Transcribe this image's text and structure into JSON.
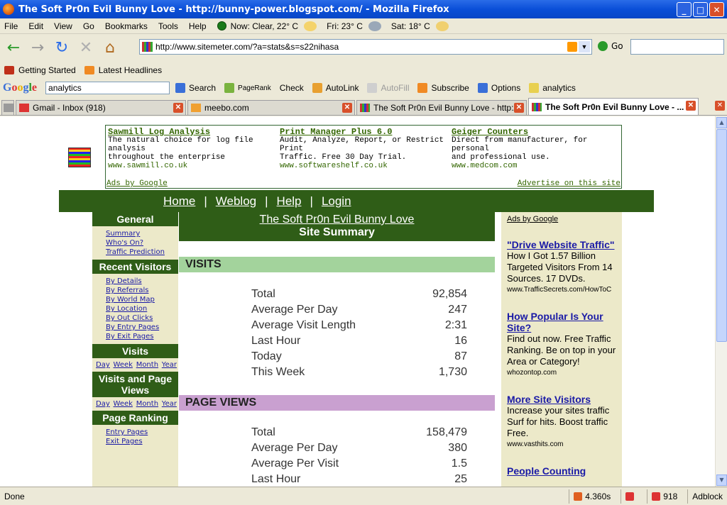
{
  "window": {
    "title": "The Soft Pr0n Evil Bunny Love - http://bunny-power.blogspot.com/ - Mozilla Firefox",
    "min": "_",
    "max": "□",
    "close": "✕"
  },
  "menu": {
    "items": [
      "File",
      "Edit",
      "View",
      "Go",
      "Bookmarks",
      "Tools",
      "Help"
    ],
    "weather_now": "Now: Clear, 22° C",
    "weather_fri": "Fri: 23° C",
    "weather_sat": "Sat: 18° C"
  },
  "nav": {
    "url": "http://www.sitemeter.com/?a=stats&s=s22nihasa",
    "go": "Go",
    "back": "←",
    "forward": "→",
    "reload": "↻",
    "stop": "✕",
    "home": "⌂"
  },
  "bookmarks": [
    "Getting Started",
    "Latest Headlines"
  ],
  "google_toolbar": {
    "logo": "Google",
    "query": "analytics",
    "search": "Search",
    "pagerank": "PageRank",
    "check": "Check",
    "autolink": "AutoLink",
    "autofill": "AutoFill",
    "subscribe": "Subscribe",
    "options": "Options",
    "analytics": "analytics"
  },
  "tabs": [
    "Gmail - Inbox (918)",
    "meebo.com",
    "The Soft Pr0n Evil Bunny Love - http:/...",
    "The Soft Pr0n Evil Bunny Love - ..."
  ],
  "ads": [
    {
      "title": "Sawmill Log Analysis",
      "lines": [
        "The natural choice for log file analysis",
        "throughout the enterprise"
      ],
      "url": "www.sawmill.co.uk"
    },
    {
      "title": "Print Manager Plus 6.0",
      "lines": [
        "Audit, Analyze, Report, or Restrict Print",
        "Traffic. Free 30 Day Trial."
      ],
      "url": "www.softwareshelf.co.uk"
    },
    {
      "title": "Geiger Counters",
      "lines": [
        "Direct from manufacturer, for personal",
        "and professional use."
      ],
      "url": "www.medcom.com"
    }
  ],
  "ads_by": "Ads by Google",
  "advertise": "Advertise on this site",
  "topnav": [
    "Home",
    "Weblog",
    "Help",
    "Login"
  ],
  "sidebar": {
    "general": {
      "title": "General",
      "links": [
        "Summary",
        "Who's On?",
        "Traffic Prediction"
      ]
    },
    "recent": {
      "title": "Recent Visitors",
      "links": [
        "By Details",
        "By Referrals",
        "By World Map",
        "By Location",
        "By Out Clicks",
        "By Entry Pages",
        "By Exit Pages"
      ]
    },
    "visits": {
      "title": "Visits",
      "links": [
        "Day",
        "Week",
        "Month",
        "Year"
      ]
    },
    "pageviews": {
      "title": "Visits and Page Views",
      "links": [
        "Day",
        "Week",
        "Month",
        "Year"
      ]
    },
    "ranking": {
      "title": "Page Ranking",
      "links": [
        "Entry Pages",
        "Exit Pages"
      ]
    }
  },
  "main": {
    "site_name": "The Soft Pr0n Evil Bunny Love",
    "subtitle": "Site Summary",
    "visits": {
      "title": "VISITS",
      "color": "#a3d39c",
      "rows": [
        [
          "Total",
          "92,854"
        ],
        [
          "Average Per Day",
          "247"
        ],
        [
          "Average Visit Length",
          "2:31"
        ],
        [
          "Last Hour",
          "16"
        ],
        [
          "Today",
          "87"
        ],
        [
          "This Week",
          "1,730"
        ]
      ]
    },
    "pageviews": {
      "title": "PAGE VIEWS",
      "color": "#c9a0d0",
      "rows": [
        [
          "Total",
          "158,479"
        ],
        [
          "Average Per Day",
          "380"
        ],
        [
          "Average Per Visit",
          "1.5"
        ],
        [
          "Last Hour",
          "25"
        ]
      ]
    }
  },
  "right_ads": {
    "header": "Ads by Google",
    "items": [
      {
        "title": "\"Drive Website Traffic\"",
        "desc": "How I Got 1.57 Billion Targeted Visitors From 14 Sources. 17 DVDs.",
        "url": "www.TrafficSecrets.com/HowToC"
      },
      {
        "title": "How Popular Is Your Site?",
        "desc": "Find out now. Free Traffic Ranking. Be on top in your Area or Category!",
        "url": "whozontop.com"
      },
      {
        "title": "More Site Visitors",
        "desc": "Increase your sites traffic Surf for hits. Boost traffic Free.",
        "url": "www.vasthits.com"
      },
      {
        "title": "People Counting",
        "desc": "",
        "url": ""
      }
    ]
  },
  "status": {
    "text": "Done",
    "time": "4.360s",
    "mail": "918",
    "adblock": "Adblock"
  }
}
